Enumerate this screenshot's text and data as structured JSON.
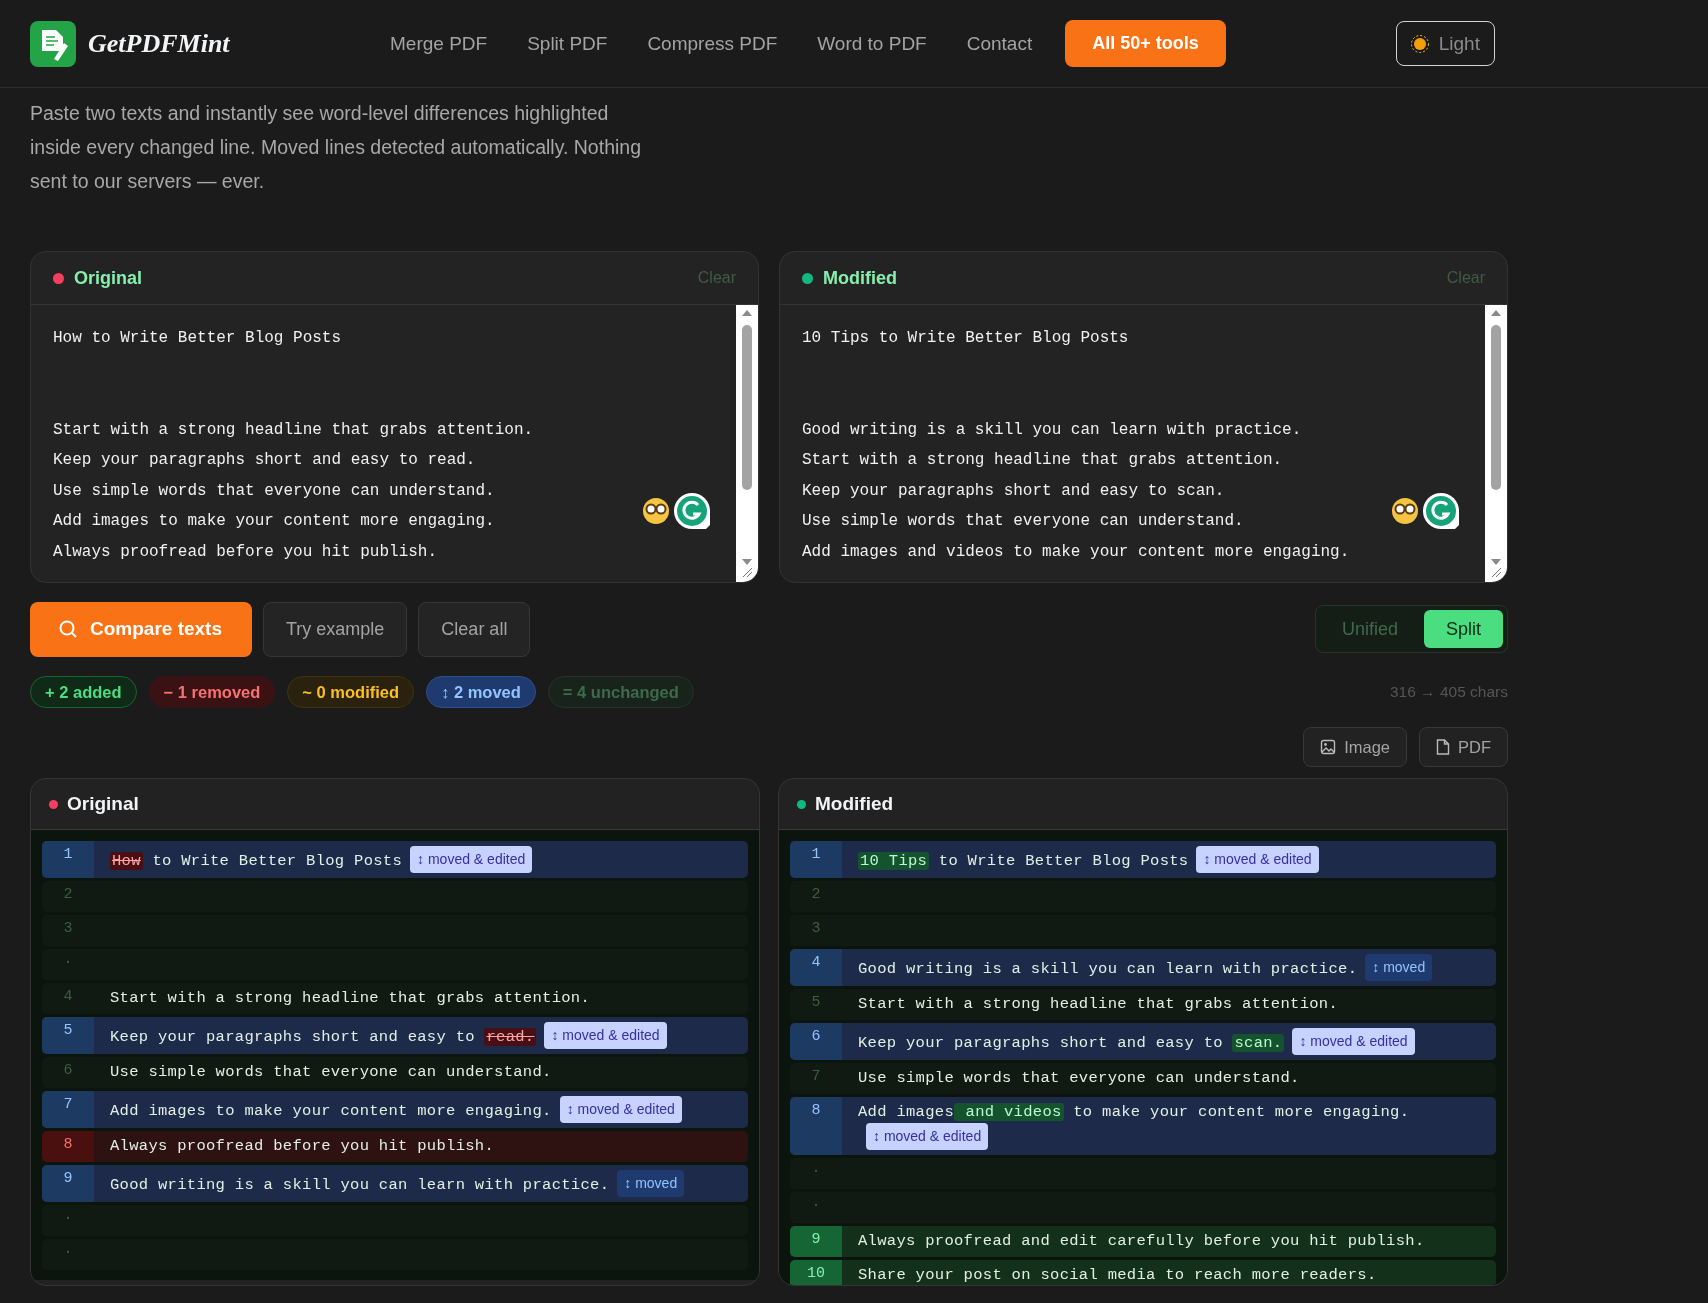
{
  "header": {
    "logo": "GetPDFMint",
    "nav": [
      "Merge PDF",
      "Split PDF",
      "Compress PDF",
      "Word to PDF",
      "Contact"
    ],
    "cta": "All 50+ tools",
    "theme_button": "Light"
  },
  "intro": "Paste two texts and instantly see word-level differences highlighted inside every changed line. Moved lines detected automatically. Nothing sent to our servers — ever.",
  "editors": [
    {
      "title": "Original",
      "color": "#f43f5e",
      "clear": "Clear",
      "value": "How to Write Better Blog Posts\n\n\nStart with a strong headline that grabs attention.\nKeep your paragraphs short and easy to read.\nUse simple words that everyone can understand.\nAdd images to make your content more engaging.\nAlways proofread before you hit publish."
    },
    {
      "title": "Modified",
      "color": "#10b981",
      "clear": "Clear",
      "value": "10 Tips to Write Better Blog Posts\n\n\nGood writing is a skill you can learn with practice.\nStart with a strong headline that grabs attention.\nKeep your paragraphs short and easy to scan.\nUse simple words that everyone can understand.\nAdd images and videos to make your content more engaging."
    }
  ],
  "actions": {
    "compare": "Compare texts",
    "example": "Try example",
    "clear_all": "Clear all"
  },
  "view_toggle": [
    {
      "label": "Unified",
      "selected": false
    },
    {
      "label": "Split",
      "selected": true
    }
  ],
  "stats": [
    {
      "kind": "added",
      "text": "+ 2 added"
    },
    {
      "kind": "removed",
      "text": "− 1 removed"
    },
    {
      "kind": "modified",
      "text": "~ 0 modified"
    },
    {
      "kind": "moved",
      "text": "↕ 2 moved"
    },
    {
      "kind": "unchanged",
      "text": "= 4 unchanged"
    }
  ],
  "char_count": "316 → 405 chars",
  "exports": [
    {
      "kind": "image",
      "label": "Image"
    },
    {
      "kind": "pdf",
      "label": "PDF"
    }
  ],
  "diff_panels": [
    {
      "title": "Original",
      "color": "#f43f5e",
      "rows": [
        {
          "kind": "moved",
          "number": "1",
          "segments": [
            {
              "text": "How",
              "deleted": true
            },
            {
              "text": " to Write Better Blog Posts"
            }
          ],
          "badge": {
            "kind": "moved-edited",
            "text": "↕ moved & edited"
          }
        },
        {
          "kind": "unchanged",
          "number": "2"
        },
        {
          "kind": "unchanged",
          "number": "3"
        },
        {
          "kind": "unchanged",
          "number": "·"
        },
        {
          "kind": "unchanged",
          "number": "4",
          "segments": [
            {
              "text": "Start with a strong headline that grabs attention."
            }
          ]
        },
        {
          "kind": "moved",
          "number": "5",
          "segments": [
            {
              "text": "Keep your paragraphs short and easy to "
            },
            {
              "text": "read.",
              "deleted": true
            }
          ],
          "badge": {
            "kind": "moved-edited",
            "text": "↕ moved & edited"
          }
        },
        {
          "kind": "unchanged",
          "number": "6",
          "segments": [
            {
              "text": "Use simple words that everyone can understand."
            }
          ]
        },
        {
          "kind": "moved",
          "number": "7",
          "segments": [
            {
              "text": "Add images to make your content more engaging."
            }
          ],
          "badge": {
            "kind": "moved-edited",
            "text": "↕ moved & edited"
          }
        },
        {
          "kind": "removed",
          "number": "8",
          "segments": [
            {
              "text": "Always proofread before you hit publish."
            }
          ]
        },
        {
          "kind": "moved",
          "number": "9",
          "segments": [
            {
              "text": "Good writing is a skill you can learn with practice."
            }
          ],
          "badge": {
            "kind": "moved",
            "text": "↕ moved"
          }
        },
        {
          "kind": "unchanged",
          "number": "·"
        },
        {
          "kind": "unchanged",
          "number": "·"
        }
      ]
    },
    {
      "title": "Modified",
      "color": "#10b981",
      "rows": [
        {
          "kind": "moved",
          "number": "1",
          "segments": [
            {
              "text": "10 Tips",
              "inserted": true
            },
            {
              "text": " to Write Better Blog Posts"
            }
          ],
          "badge": {
            "kind": "moved-edited",
            "text": "↕ moved & edited"
          }
        },
        {
          "kind": "unchanged",
          "number": "2"
        },
        {
          "kind": "unchanged",
          "number": "3"
        },
        {
          "kind": "moved",
          "number": "4",
          "segments": [
            {
              "text": "Good writing is a skill you can learn with practice."
            }
          ],
          "badge": {
            "kind": "moved",
            "text": "↕ moved"
          }
        },
        {
          "kind": "unchanged",
          "number": "5",
          "segments": [
            {
              "text": "Start with a strong headline that grabs attention."
            }
          ]
        },
        {
          "kind": "moved",
          "number": "6",
          "segments": [
            {
              "text": "Keep your paragraphs short and easy to "
            },
            {
              "text": "scan.",
              "inserted": true
            }
          ],
          "badge": {
            "kind": "moved-edited",
            "text": "↕ moved & edited"
          }
        },
        {
          "kind": "unchanged",
          "number": "7",
          "segments": [
            {
              "text": "Use simple words that everyone can understand."
            }
          ]
        },
        {
          "kind": "moved",
          "number": "8",
          "segments": [
            {
              "text": "Add images"
            },
            {
              "text": " and videos",
              "inserted": true
            },
            {
              "text": " to make your content more engaging."
            }
          ],
          "badge": {
            "kind": "moved-edited",
            "text": "↕ moved & edited"
          }
        },
        {
          "kind": "unchanged",
          "number": "·"
        },
        {
          "kind": "unchanged",
          "number": "·"
        },
        {
          "kind": "added",
          "number": "9",
          "segments": [
            {
              "text": "Always proofread and edit carefully before you hit publish."
            }
          ]
        },
        {
          "kind": "added",
          "number": "10",
          "segments": [
            {
              "text": "Share your post on social media to reach more readers."
            }
          ]
        }
      ]
    }
  ]
}
